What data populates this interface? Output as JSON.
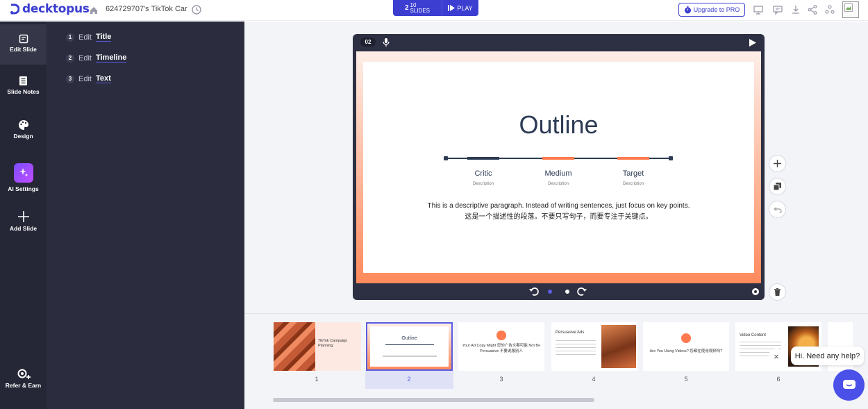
{
  "app": {
    "brand": "decktopus",
    "doc_title": "624729707's TikTok Car",
    "accent": "#3b3ed0"
  },
  "topbar": {
    "slides_current": "2",
    "slides_total": "10",
    "slides_word": "SLIDES",
    "play_label": "PLAY",
    "upgrade_label": "Upgrade to PRO",
    "icons": [
      "present-icon",
      "comment-icon",
      "download-icon",
      "share-icon",
      "collaborators-icon"
    ]
  },
  "sidebar": {
    "items": [
      {
        "label": "Edit Slide",
        "icon": "edit-slide-icon"
      },
      {
        "label": "Slide Notes",
        "icon": "notes-icon"
      },
      {
        "label": "Design",
        "icon": "palette-icon"
      },
      {
        "label": "AI Settings",
        "icon": "sparkle-icon"
      },
      {
        "label": "Add Slide",
        "icon": "plus-icon"
      }
    ],
    "refer": {
      "label": "Refer & Earn",
      "icon": "refer-icon"
    }
  },
  "panel": {
    "items": [
      {
        "num": "1",
        "prefix": "Edit",
        "target": "Title"
      },
      {
        "num": "2",
        "prefix": "Edit",
        "target": "Timeline"
      },
      {
        "num": "3",
        "prefix": "Edit",
        "target": "Text"
      }
    ]
  },
  "slide": {
    "badge": "02",
    "title": "Outline",
    "timeline": [
      {
        "label": "Critic",
        "desc": "Description",
        "color": "#2d3b55"
      },
      {
        "label": "Medium",
        "desc": "Description",
        "color": "#ff7b4f"
      },
      {
        "label": "Target",
        "desc": "Description",
        "color": "#ff7b4f"
      }
    ],
    "paragraph_en": "This is a descriptive paragraph. Instead of writing sentences, just focus on key points.",
    "paragraph_zh": "这是一个描述性的段落。不要只写句子，而要专注于关键点。"
  },
  "thumbnails": [
    {
      "num": "1",
      "title": "TikTok Campaign Planning"
    },
    {
      "num": "2",
      "title": "Outline"
    },
    {
      "num": "3",
      "title": "Your Ad Copy Might 您的广告文案可能 Not Be Persuasive 不要说服别人"
    },
    {
      "num": "4",
      "title": "Persuasive Ads"
    },
    {
      "num": "5",
      "title": "Are You Using Videos? 您都在使用视频吗?"
    },
    {
      "num": "6",
      "title": "Video Content"
    }
  ],
  "help": {
    "text": "Hi. Need any help?",
    "close": "×"
  }
}
